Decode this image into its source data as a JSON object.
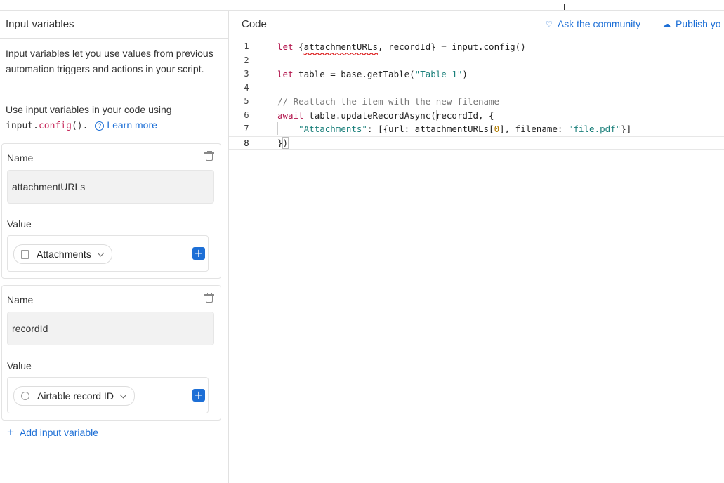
{
  "left_panel": {
    "title": "Input variables",
    "desc_1": "Input variables let you use values from previous automation triggers and actions in your script.",
    "desc_2_prefix": "Use input variables in your code using",
    "desc_2_code_a": "input.",
    "desc_2_code_b": "config",
    "desc_2_code_c": "().",
    "learn_more": "Learn more",
    "cards": [
      {
        "name_label": "Name",
        "name_value": "attachmentURLs",
        "value_label": "Value",
        "value_pill": "Attachments"
      },
      {
        "name_label": "Name",
        "name_value": "recordId",
        "value_label": "Value",
        "value_pill": "Airtable record ID"
      }
    ],
    "add_variable": "Add input variable"
  },
  "right_panel": {
    "title": "Code",
    "ask_community": "Ask the community",
    "publish": "Publish yo"
  },
  "code": {
    "line_numbers": [
      "1",
      "2",
      "3",
      "4",
      "5",
      "6",
      "7",
      "8"
    ],
    "l1_a": "let",
    "l1_b": " {",
    "l1_c": "attachmentURLs",
    "l1_d": ", recordId} = input.config()",
    "l3_a": "let",
    "l3_b": " table = base.getTable(",
    "l3_c": "\"Table 1\"",
    "l3_d": ")",
    "l5": "// Reattach the item with the new filename",
    "l6_a": "await",
    "l6_b": " table.updateRecordAsync",
    "l6_c": "(",
    "l6_d": "recordId, {",
    "l7_a": "    ",
    "l7_b": "\"Attachments\"",
    "l7_c": ": [{url: attachmentURLs[",
    "l7_d": "0",
    "l7_e": "], filename: ",
    "l7_f": "\"file.pdf\"",
    "l7_g": "}]",
    "l8_a": "}",
    "l8_b": ")"
  },
  "colors": {
    "accent": "#1d6fd6",
    "keyword": "#b3164d",
    "string": "#1a7f7a",
    "comment": "#777777"
  }
}
